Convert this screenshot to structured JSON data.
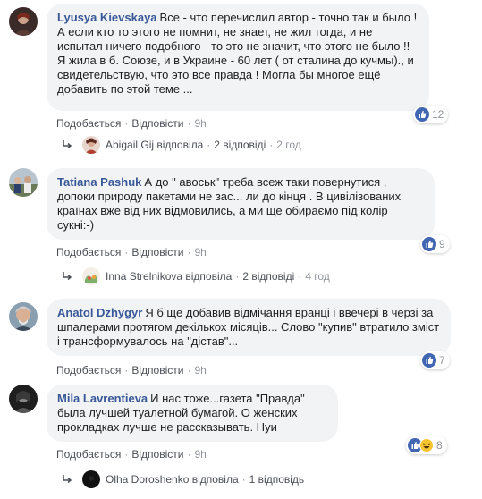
{
  "labels": {
    "like": "Подобається",
    "reply": "Відповісти",
    "dot": "·"
  },
  "comments": [
    {
      "author": "Lyusya Kievskaya",
      "text": "Все - что перечислил автор - точно так и было ! А если кто то этого не помнит, не знает, не жил тогда, и не испытал ничего подобного - то это не значит, что этого не было !! Я жила в б. Союзе, и в Украине - 60 лет ( от сталина до кучмы)., и свидетельствую, что это все правда ! Могла бы многое ещё добавить по этой теме ...",
      "time": "9h",
      "reactions": "12",
      "reply": {
        "name": "Abigail Gij відповіла",
        "count": "2 відповіді",
        "time": "2 год"
      }
    },
    {
      "author": "Tatiana Pashuk",
      "text": "А до \" авоськ\" треба всеж таки повернутися , допоки природу пакетами не зас... ли до кінця . В цивілізованих країнах вже від них відмовились, а ми ще обираємо під колір сукні:-)",
      "time": "9h",
      "reactions": "9",
      "reply": {
        "name": "Inna Strelnikova відповіла",
        "count": "2 відповіді",
        "time": "4 год"
      }
    },
    {
      "author": "Anatol Dzhygyr",
      "text": "Я б ще добавив відмічання вранці і ввечері в черзі за шпалерами протягом декількох місяців... Слово \"купив\" втратило зміст і трансформувалось на \"дістав\"...",
      "time": "9h",
      "reactions": "7"
    },
    {
      "author": "Mila Lavrentieva",
      "text": "И нас тоже...газета \"Правда\" была лучшей туалетной бумагой. О женских прокладках лучше не рассказывать. Нуи",
      "time": "9h",
      "reactions": "8",
      "reply": {
        "name": "Olha Doroshenko відповіла",
        "count": "1 відповідь"
      }
    }
  ],
  "colors": {
    "link": "#385898",
    "bubble": "#f2f3f5",
    "like": "#4267b2",
    "haha": "#f7c431"
  }
}
